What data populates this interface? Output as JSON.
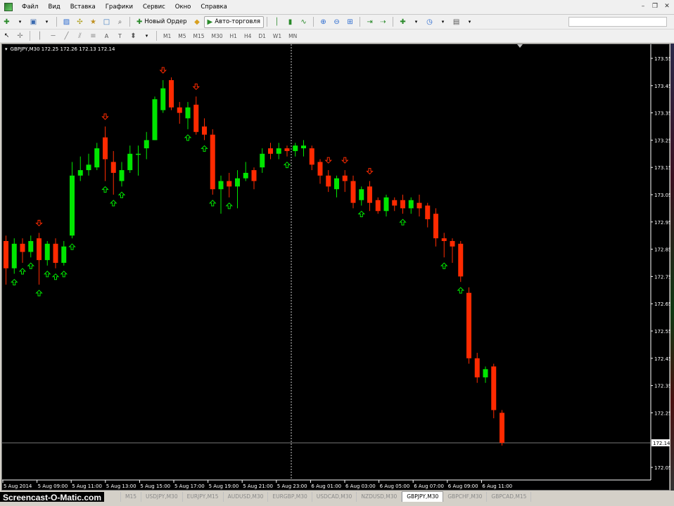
{
  "menu": [
    "Файл",
    "Вид",
    "Вставка",
    "Графики",
    "Сервис",
    "Окно",
    "Справка"
  ],
  "toolbar": {
    "new_order": "Новый Ордер",
    "auto_trading": "Авто-торговля",
    "timeframes": [
      "M1",
      "M5",
      "M15",
      "M30",
      "H1",
      "H4",
      "D1",
      "W1",
      "MN"
    ]
  },
  "chart": {
    "symbol_line": "GBPJPY,M30  172.25 172.26 172.13 172.14",
    "current_price": "172.14",
    "colors": {
      "bull": "#00e600",
      "bear": "#ff2a00",
      "background": "#000000",
      "grid": "#ffffff"
    }
  },
  "chart_data": {
    "type": "candlestick",
    "symbol": "GBPJPY",
    "timeframe": "M30",
    "ylim": [
      172.0,
      173.55
    ],
    "y_ticks": [
      "173.55",
      "173.45",
      "173.35",
      "173.25",
      "173.15",
      "173.05",
      "172.95",
      "172.85",
      "172.75",
      "172.65",
      "172.55",
      "172.45",
      "172.35",
      "172.25",
      "172.14",
      "172.05"
    ],
    "x_ticks": [
      "5 Aug 2014",
      "5 Aug 09:00",
      "5 Aug 11:00",
      "5 Aug 13:00",
      "5 Aug 15:00",
      "5 Aug 17:00",
      "5 Aug 19:00",
      "5 Aug 21:00",
      "5 Aug 23:00",
      "6 Aug 01:00",
      "6 Aug 03:00",
      "6 Aug 05:00",
      "6 Aug 07:00",
      "6 Aug 09:00",
      "6 Aug 11:00"
    ],
    "candles": [
      [
        172.88,
        172.78,
        172.9,
        172.72
      ],
      [
        172.78,
        172.87,
        172.89,
        172.76
      ],
      [
        172.87,
        172.84,
        172.89,
        172.8
      ],
      [
        172.84,
        172.88,
        172.9,
        172.82
      ],
      [
        172.89,
        172.81,
        172.91,
        172.72
      ],
      [
        172.81,
        172.87,
        172.88,
        172.79
      ],
      [
        172.87,
        172.8,
        172.89,
        172.78
      ],
      [
        172.8,
        172.86,
        172.88,
        172.79
      ],
      [
        172.9,
        173.12,
        173.17,
        172.89
      ],
      [
        173.12,
        173.14,
        173.19,
        173.1
      ],
      [
        173.14,
        173.16,
        173.2,
        173.12
      ],
      [
        173.15,
        173.22,
        173.24,
        173.14
      ],
      [
        173.26,
        173.18,
        173.3,
        173.1
      ],
      [
        173.17,
        173.13,
        173.21,
        173.05
      ],
      [
        173.1,
        173.14,
        173.17,
        173.08
      ],
      [
        173.14,
        173.2,
        173.23,
        173.13
      ],
      [
        173.2,
        173.2,
        173.23,
        173.12
      ],
      [
        173.22,
        173.25,
        173.28,
        173.18
      ],
      [
        173.25,
        173.4,
        173.41,
        173.25
      ],
      [
        173.36,
        173.44,
        173.47,
        173.35
      ],
      [
        173.47,
        173.37,
        173.48,
        173.36
      ],
      [
        173.37,
        173.35,
        173.39,
        173.31
      ],
      [
        173.33,
        173.37,
        173.39,
        173.29
      ],
      [
        173.38,
        173.28,
        173.41,
        173.27
      ],
      [
        173.3,
        173.27,
        173.33,
        173.25
      ],
      [
        173.27,
        173.07,
        173.29,
        173.05
      ],
      [
        173.07,
        173.1,
        173.12,
        172.98
      ],
      [
        173.1,
        173.08,
        173.13,
        173.04
      ],
      [
        173.08,
        173.11,
        173.14,
        173.0
      ],
      [
        173.11,
        173.13,
        173.17,
        173.1
      ],
      [
        173.14,
        173.1,
        173.15,
        173.07
      ],
      [
        173.15,
        173.2,
        173.22,
        173.13
      ],
      [
        173.22,
        173.2,
        173.24,
        173.18
      ],
      [
        173.2,
        173.22,
        173.24,
        173.18
      ],
      [
        173.22,
        173.21,
        173.23,
        173.19
      ],
      [
        173.21,
        173.23,
        173.24,
        173.19
      ],
      [
        173.22,
        173.23,
        173.25,
        173.19
      ],
      [
        173.22,
        173.16,
        173.23,
        173.14
      ],
      [
        173.17,
        173.12,
        173.18,
        173.09
      ],
      [
        173.12,
        173.08,
        173.14,
        173.06
      ],
      [
        173.07,
        173.11,
        173.12,
        173.04
      ],
      [
        173.12,
        173.1,
        173.14,
        173.06
      ],
      [
        173.1,
        173.02,
        173.12,
        173.0
      ],
      [
        173.03,
        173.07,
        173.08,
        173.01
      ],
      [
        173.08,
        173.02,
        173.1,
        172.99
      ],
      [
        173.03,
        172.99,
        173.04,
        172.98
      ],
      [
        172.99,
        173.04,
        173.05,
        172.97
      ],
      [
        173.03,
        173.01,
        173.04,
        172.99
      ],
      [
        173.03,
        173.0,
        173.05,
        172.98
      ],
      [
        173.0,
        173.03,
        173.04,
        172.98
      ],
      [
        173.02,
        173.0,
        173.05,
        172.97
      ],
      [
        173.01,
        172.96,
        173.02,
        172.93
      ],
      [
        172.98,
        172.89,
        173.0,
        172.86
      ],
      [
        172.89,
        172.88,
        172.91,
        172.82
      ],
      [
        172.88,
        172.86,
        172.89,
        172.8
      ],
      [
        172.87,
        172.75,
        172.88,
        172.73
      ],
      [
        172.69,
        172.45,
        172.71,
        172.43
      ],
      [
        172.45,
        172.38,
        172.47,
        172.36
      ],
      [
        172.38,
        172.41,
        172.42,
        172.36
      ],
      [
        172.42,
        172.26,
        172.43,
        172.23
      ],
      [
        172.25,
        172.14,
        172.26,
        172.13
      ]
    ],
    "arrows_up": [
      1,
      2,
      3,
      4,
      5,
      6,
      7,
      8,
      12,
      13,
      14,
      22,
      24,
      25,
      27,
      34,
      43,
      48,
      53,
      55
    ],
    "arrows_down": [
      4,
      12,
      19,
      23,
      39,
      41,
      44
    ]
  },
  "tabs": [
    "Screencast-O-Matic.com",
    "M15",
    "USDJPY,M30",
    "EURJPY,M15",
    "AUDUSD,M30",
    "EURGBP,M30",
    "USDCAD,M30",
    "NZDUSD,M30",
    "GBPJPY,M30",
    "GBPCHF,M30",
    "GBPCAD,M15"
  ]
}
